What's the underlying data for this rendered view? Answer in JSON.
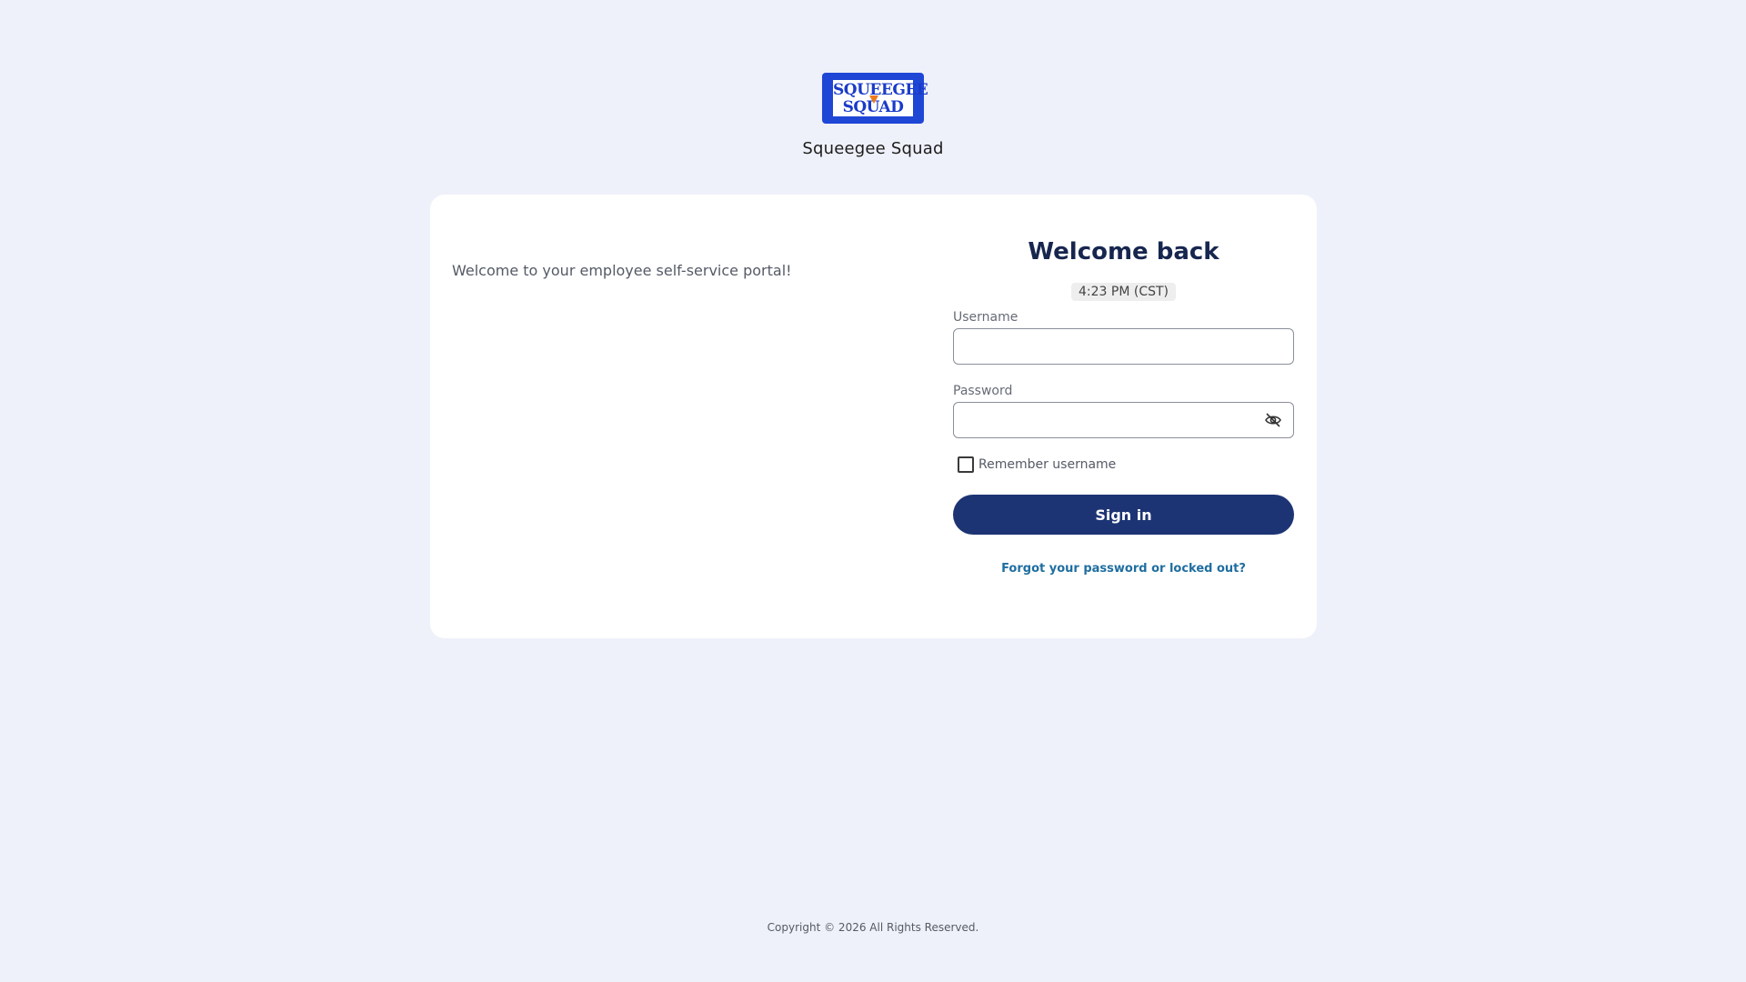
{
  "brand": {
    "logo_line1": "SQUEEGEE",
    "logo_line2": "SQUAD",
    "name": "Squeegee Squad",
    "logo_bg_color": "#1f47d6",
    "logo_accent_color": "#f07a1c"
  },
  "intro": {
    "text": "Welcome to your employee self-service portal!"
  },
  "login": {
    "title": "Welcome back",
    "time": "4:23 PM (CST)",
    "username_label": "Username",
    "username_value": "",
    "password_label": "Password",
    "password_value": "",
    "password_toggle_icon": "eye-off-icon",
    "remember_label": "Remember username",
    "remember_checked": false,
    "signin_label": "Sign in",
    "forgot_link": "Forgot your password or locked out?",
    "primary_color": "#1d3474",
    "link_color": "#1f6ea0"
  },
  "footer": {
    "copyright": "Copyright © 2026 All Rights Reserved."
  }
}
